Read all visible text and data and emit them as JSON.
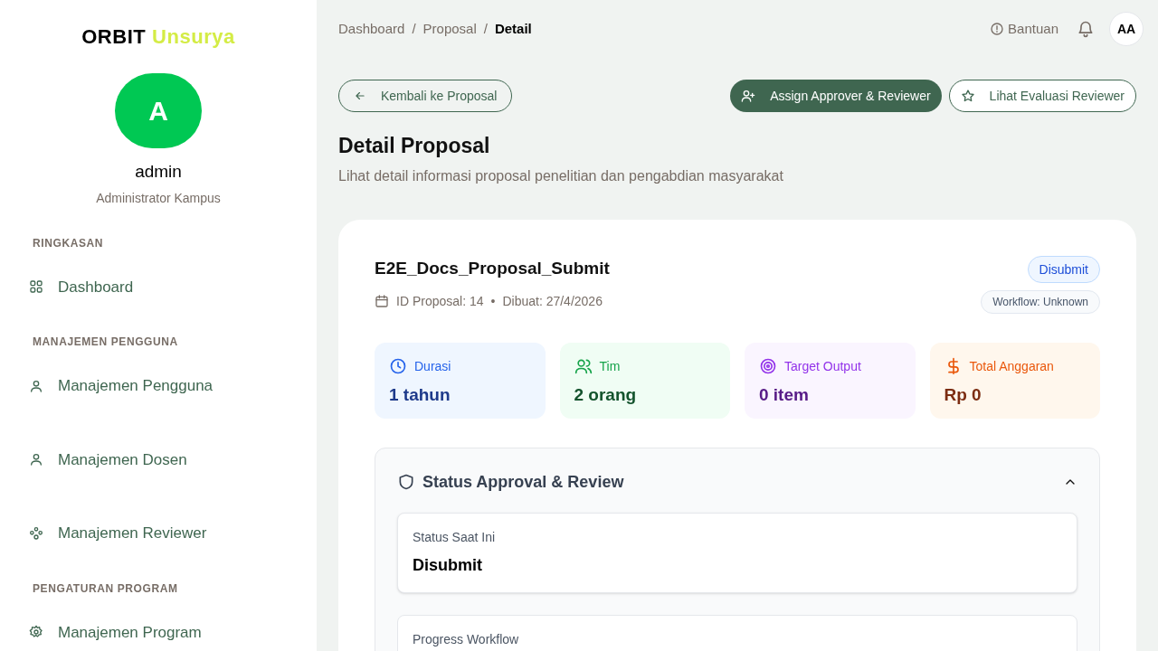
{
  "sidebar": {
    "brand": {
      "name": "ORBIT",
      "accent": "Unsurya"
    },
    "avatar": "A",
    "user_name": "admin",
    "user_role": "Administrator Kampus",
    "sections": [
      {
        "title": "RINGKASAN",
        "items": [
          {
            "label": "Dashboard",
            "kind": "grid"
          }
        ]
      },
      {
        "title": "MANAJEMEN PENGGUNA",
        "items": [
          {
            "label": "Manajemen Pengguna",
            "kind": "user"
          },
          {
            "label": "Manajemen Dosen",
            "kind": "user"
          },
          {
            "label": "Manajemen Reviewer",
            "kind": "group"
          }
        ]
      },
      {
        "title": "PENGATURAN PROGRAM",
        "items": [
          {
            "label": "Manajemen Program",
            "kind": "gear"
          }
        ]
      }
    ]
  },
  "topbar": {
    "separator": "/",
    "breadcrumbs": [
      {
        "label": "Dashboard",
        "current": false
      },
      {
        "label": "Proposal",
        "current": false
      },
      {
        "label": "Detail",
        "current": true
      }
    ],
    "help": "Bantuan",
    "avatar": "AA"
  },
  "actions": {
    "back": "Kembali ke Proposal",
    "assign": "Assign Approver & Reviewer",
    "evaluation": "Lihat Evaluasi Reviewer"
  },
  "page": {
    "title": "Detail Proposal",
    "subtitle": "Lihat detail informasi proposal penelitian dan pengabdian masyarakat"
  },
  "proposal": {
    "title": "E2E_Docs_Proposal_Submit",
    "id": "ID Proposal: 14",
    "created": "Dibuat: 27/4/2026",
    "meta_separator": "•",
    "status": "Disubmit",
    "workflow": "Workflow: Unknown",
    "stats": [
      {
        "kind": "duration",
        "label": "Durasi",
        "value": "1 tahun"
      },
      {
        "kind": "team",
        "label": "Tim",
        "value": "2 orang"
      },
      {
        "kind": "target",
        "label": "Target Output",
        "value": "0 item"
      },
      {
        "kind": "budget",
        "label": "Total Anggaran",
        "value": "Rp 0"
      }
    ]
  },
  "approval": {
    "title": "Status Approval & Review",
    "expanded": true,
    "current_label": "Status Saat Ini",
    "current_value": "Disubmit",
    "progress_label": "Progress Workflow"
  }
}
